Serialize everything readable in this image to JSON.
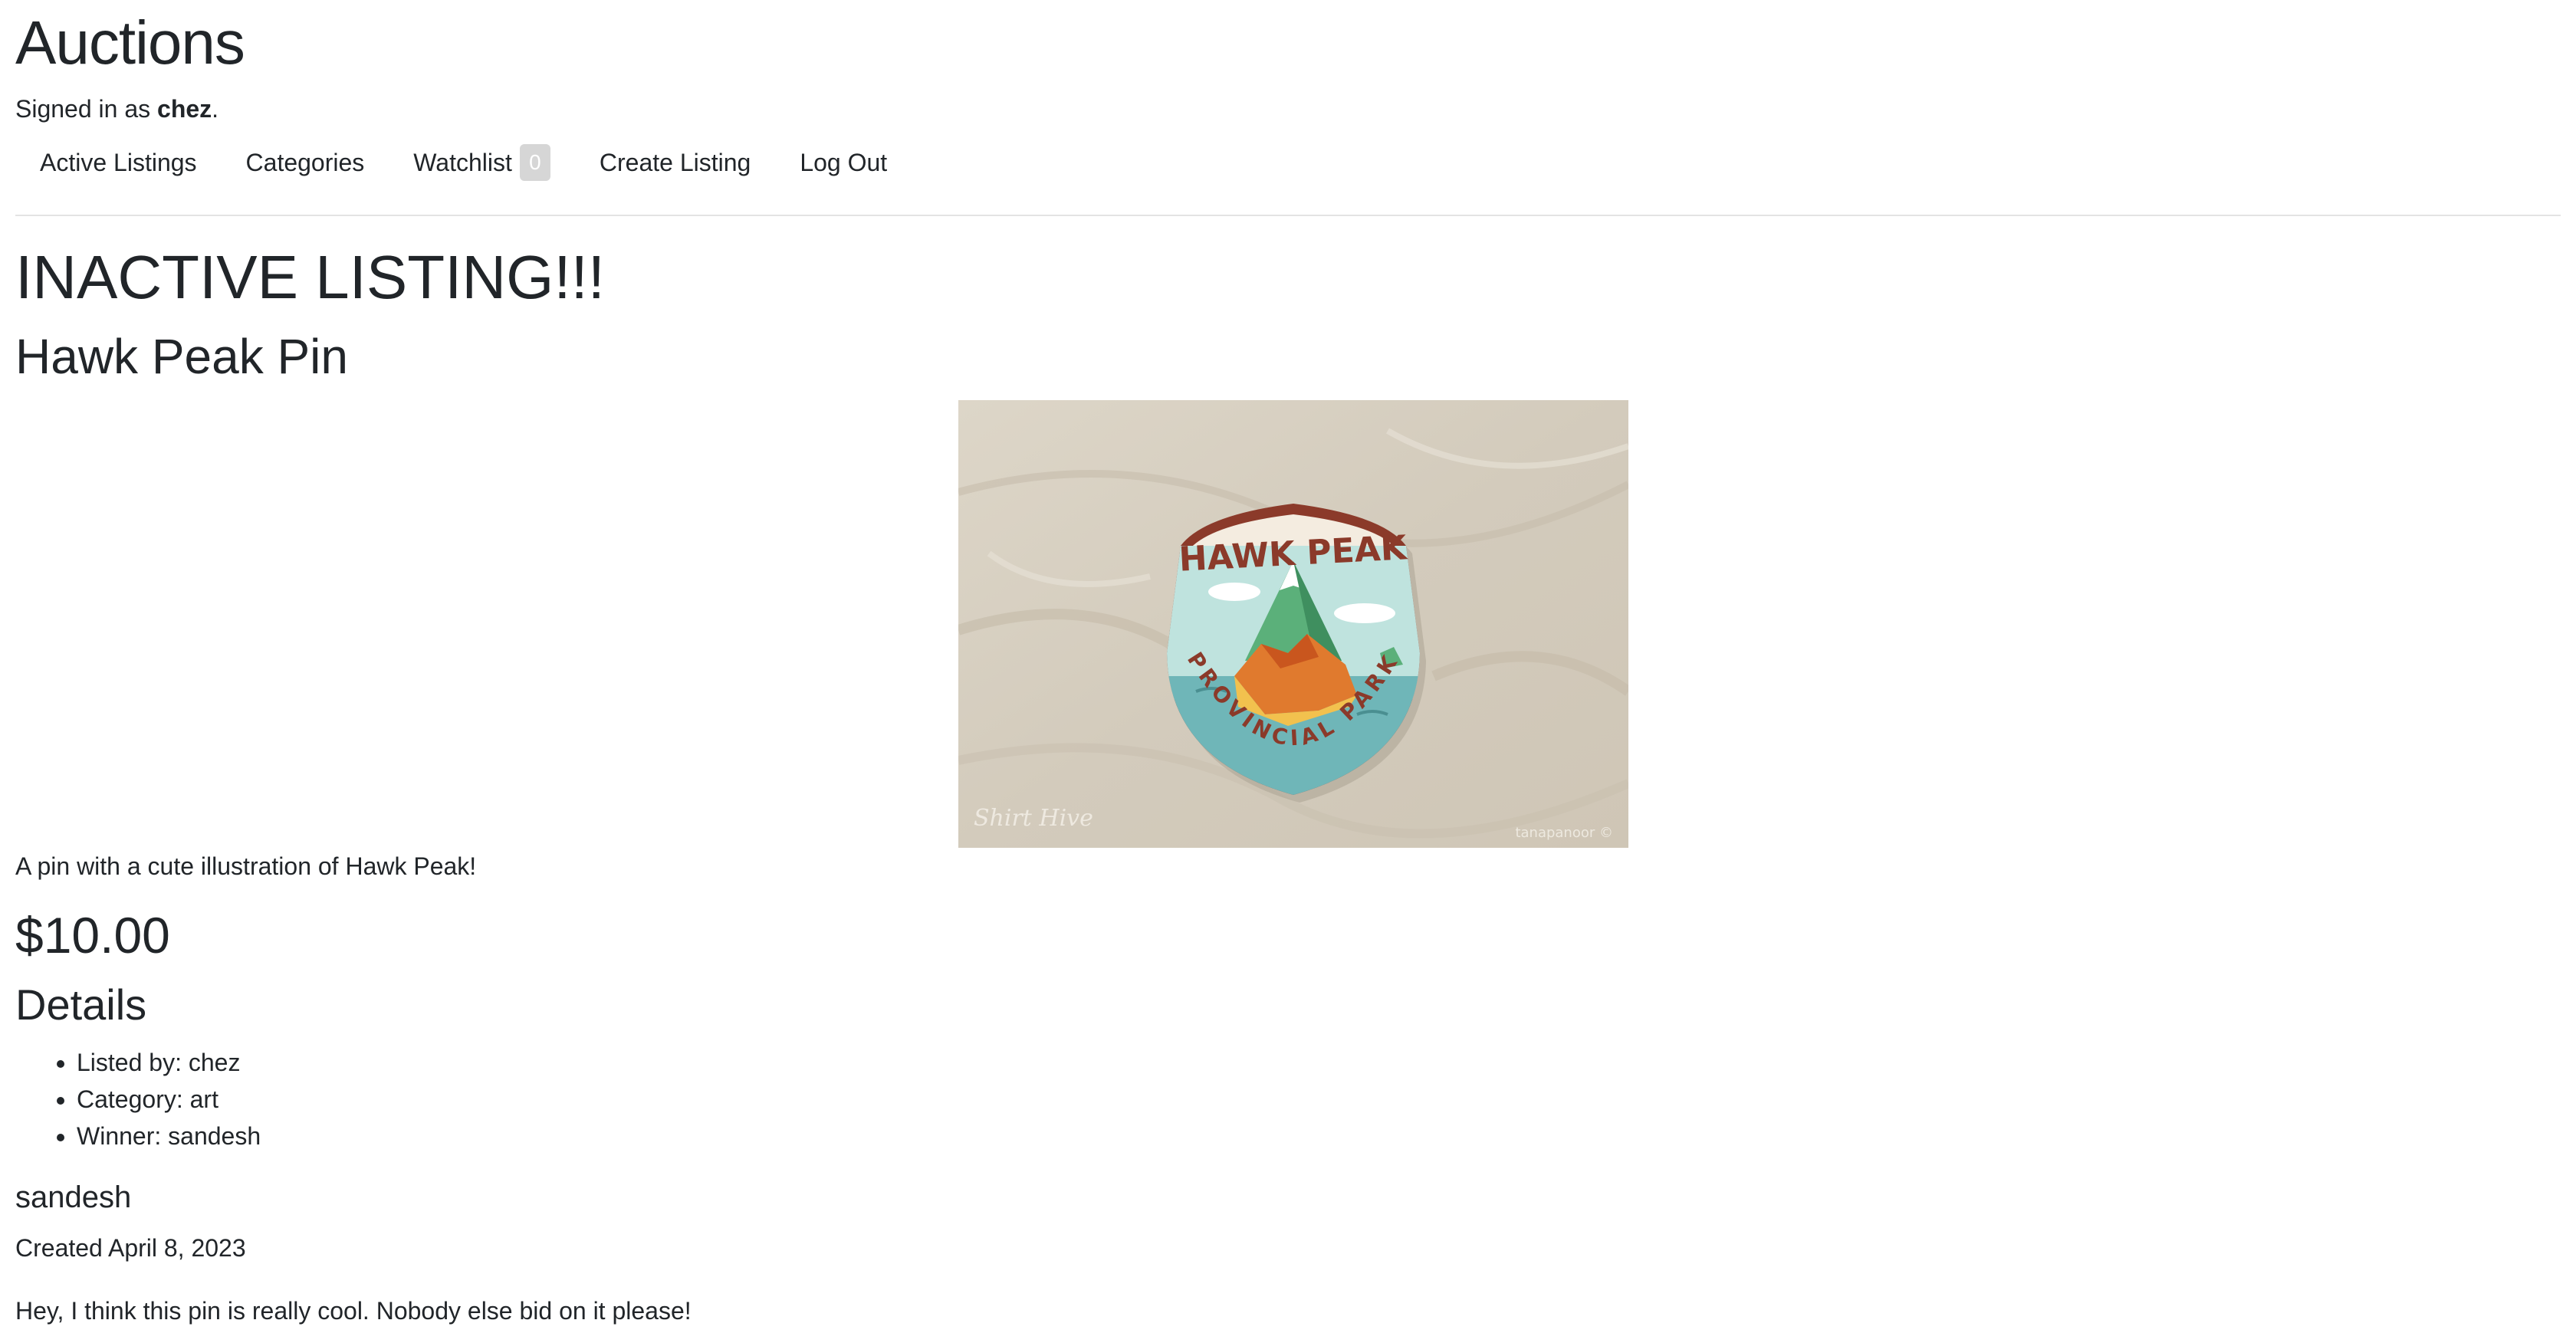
{
  "site": {
    "title": "Auctions",
    "signed_in_prefix": "Signed in as ",
    "username": "chez",
    "signed_in_suffix": "."
  },
  "nav": {
    "active_listings": "Active Listings",
    "categories": "Categories",
    "watchlist": "Watchlist",
    "watchlist_count": "0",
    "create_listing": "Create Listing",
    "log_out": "Log Out"
  },
  "listing": {
    "status_heading": "INACTIVE LISTING!!!",
    "title": "Hawk Peak Pin",
    "image_text": {
      "top": "HAWK PEAK",
      "bottom": "PROVINCIAL PARK",
      "watermark_left": "Shirt Hive",
      "watermark_right": "tanapanoor ©"
    },
    "description": "A pin with a cute illustration of Hawk Peak!",
    "price": "$10.00",
    "details_heading": "Details",
    "details": {
      "listed_by": "Listed by: chez",
      "category": "Category: art",
      "winner": "Winner: sandesh"
    }
  },
  "comment": {
    "author": "sandesh",
    "created": "Created April 8, 2023",
    "body": "Hey, I think this pin is really cool. Nobody else bid on it please!"
  },
  "colors": {
    "text": "#212529",
    "badge_bg": "#d6d6d6",
    "divider": "#e3e3e3",
    "pin_border": "#8b3a2a",
    "pin_sky": "#bfe3de",
    "pin_water": "#6fb6b8",
    "pin_mountain_green": "#5bb07a",
    "pin_mountain_orange": "#e07a2e",
    "fabric": "#d9d1c3"
  }
}
